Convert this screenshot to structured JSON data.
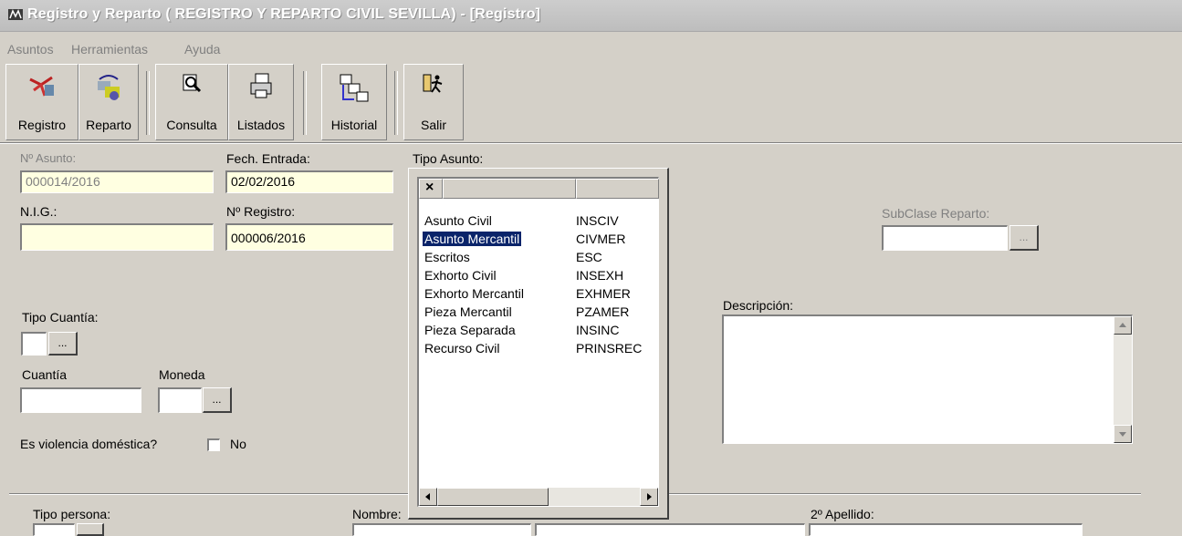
{
  "window": {
    "title": "Registro y Reparto  ( REGISTRO Y REPARTO CIVIL SEVILLA) - [Registro]"
  },
  "menu": [
    "Asuntos",
    "Herramientas",
    "Ayuda"
  ],
  "toolbar": {
    "registro": "Registro",
    "reparto": "Reparto",
    "consulta": "Consulta",
    "listados": "Listados",
    "historial": "Historial",
    "salir": "Salir"
  },
  "form": {
    "num_asunto_label": "Nº Asunto:",
    "num_asunto_value": "000014/2016",
    "fech_entrada_label": "Fech. Entrada:",
    "fech_entrada_value": "02/02/2016",
    "nig_label": "N.I.G.:",
    "nig_value": "",
    "num_registro_label": "Nº Registro:",
    "num_registro_value": "000006/2016",
    "tipo_asunto_label": "Tipo Asunto:",
    "subclase_label": "SubClase Reparto:",
    "descripcion_label": "Descripción:",
    "tipo_cuantia_label": "Tipo Cuantía:",
    "cuantia_label": "Cuantía",
    "moneda_label": "Moneda",
    "violencia_label": "Es violencia doméstica?",
    "violencia_value": "No",
    "lookup_btn": "...",
    "tipo_persona_label": "Tipo persona:",
    "nombre_label": "Nombre:",
    "apellido2_label": "2º Apellido:"
  },
  "tipo_asunto_list": {
    "close_glyph": "×",
    "items": [
      {
        "name": "Asunto Civil",
        "code": "INSCIV"
      },
      {
        "name": "Asunto Mercantil",
        "code": "CIVMER"
      },
      {
        "name": "Escritos",
        "code": "ESC"
      },
      {
        "name": "Exhorto Civil",
        "code": "INSEXH"
      },
      {
        "name": "Exhorto Mercantil",
        "code": "EXHMER"
      },
      {
        "name": "Pieza Mercantil",
        "code": "PZAMER"
      },
      {
        "name": "Pieza Separada",
        "code": "INSINC"
      },
      {
        "name": "Recurso Civil",
        "code": "PRINSREC"
      }
    ],
    "selected": 1
  },
  "colors": {
    "face": "#d4d0c8",
    "highlight": "#0a246a",
    "field_yellow": "#ffffe1"
  }
}
